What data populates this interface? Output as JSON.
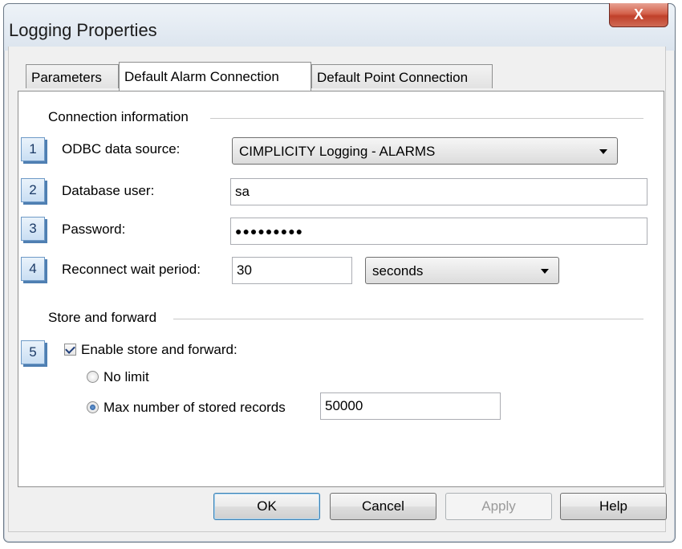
{
  "window": {
    "title": "Logging Properties",
    "close_label": "X"
  },
  "tabs": [
    {
      "label": "Parameters",
      "active": false
    },
    {
      "label": "Default Alarm Connection",
      "active": true
    },
    {
      "label": "Default Point Connection",
      "active": false
    }
  ],
  "connection_group": {
    "title": "Connection information",
    "odbc": {
      "badge": "1",
      "label": "ODBC data source:",
      "value": "CIMPLICITY Logging - ALARMS"
    },
    "user": {
      "badge": "2",
      "label": "Database user:",
      "value": "sa"
    },
    "password": {
      "badge": "3",
      "label": "Password:",
      "value": "●●●●●●●●●"
    },
    "reconnect": {
      "badge": "4",
      "label": "Reconnect wait period:",
      "value": "30",
      "unit": "seconds"
    }
  },
  "store_group": {
    "title": "Store and forward",
    "enable": {
      "badge": "5",
      "label": "Enable store and forward:",
      "checked": true
    },
    "no_limit": {
      "label": "No limit",
      "selected": false
    },
    "max_records": {
      "label": "Max number of stored records",
      "selected": true,
      "value": "50000"
    }
  },
  "buttons": {
    "ok": "OK",
    "cancel": "Cancel",
    "apply": "Apply",
    "help": "Help"
  },
  "colors": {
    "badge_accent": "#4f7fb2",
    "close_button": "#c8503a",
    "check_mark": "#1f3e7a"
  }
}
